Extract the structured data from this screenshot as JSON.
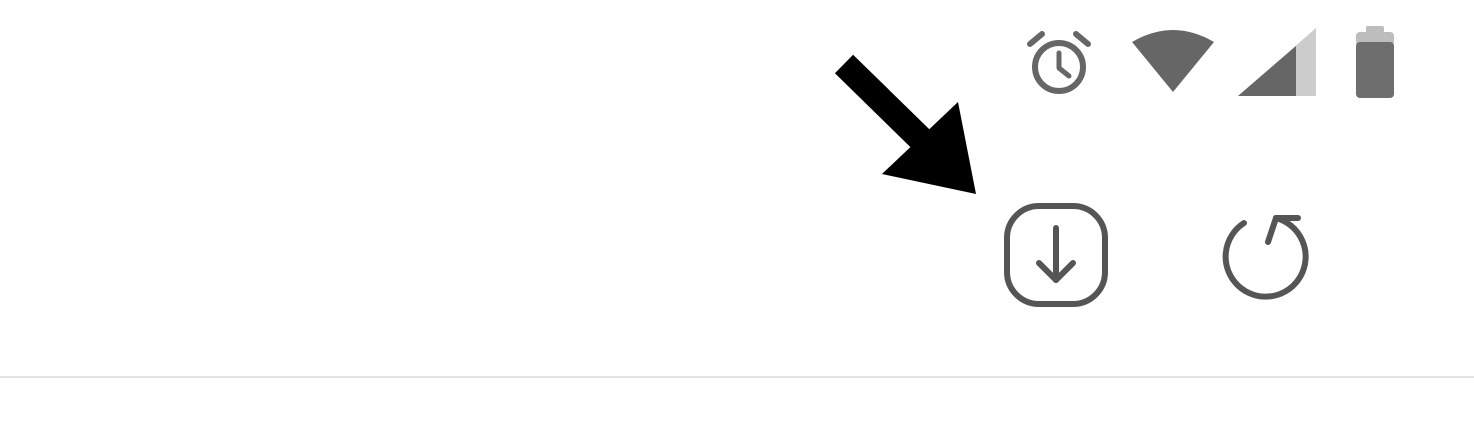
{
  "status_bar": {
    "icons": [
      "alarm-clock-icon",
      "wifi-icon",
      "cellular-signal-icon",
      "battery-icon"
    ],
    "icon_color": "#666666",
    "signal_inactive_color": "#cccccc",
    "battery_fill_color": "#6e6e6e",
    "battery_cap_color": "#bdbdbd"
  },
  "toolbar": {
    "download_icon": "download-icon",
    "refresh_icon": "refresh-icon",
    "icon_color": "#555555"
  },
  "annotation": {
    "arrow_icon": "pointer-arrow-icon",
    "arrow_color": "#000000",
    "target": "download-button"
  },
  "divider_color": "#e3e3e3"
}
